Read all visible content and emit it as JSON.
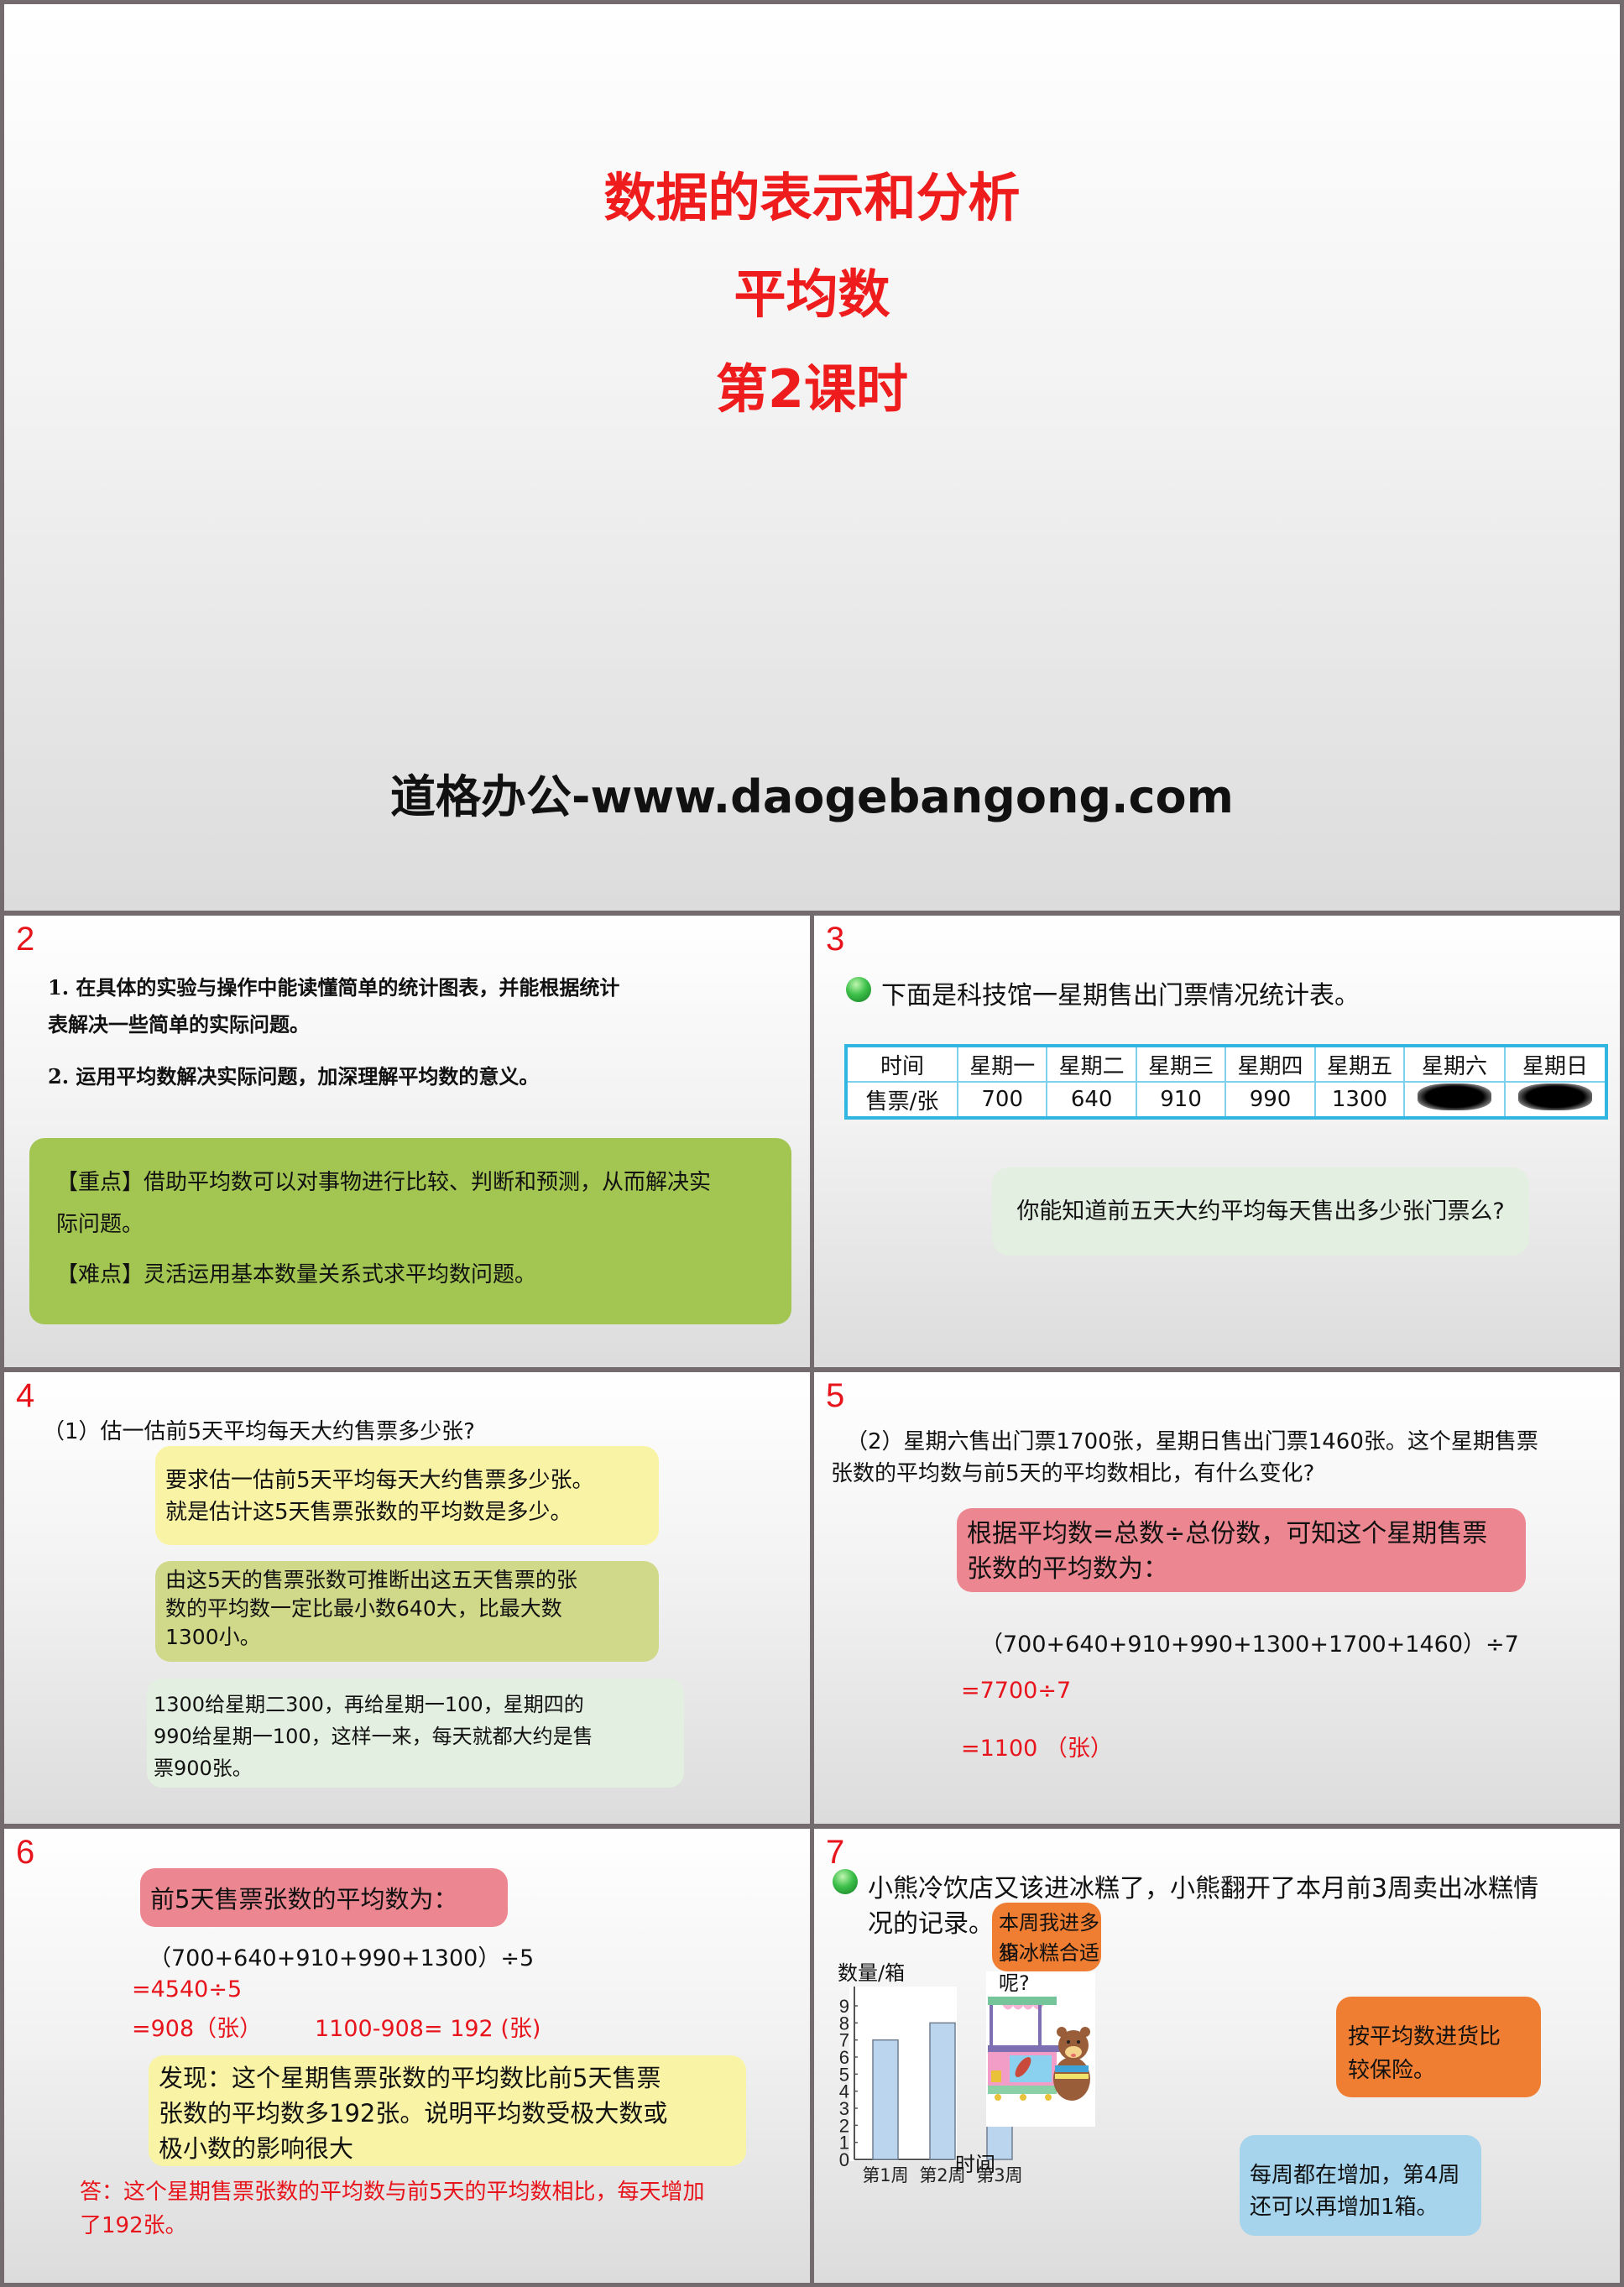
{
  "slide1": {
    "title": "数据的表示和分析",
    "subtitle": "平均数",
    "lesson": "第2课时",
    "brand": "道格办公-www.daogebangong.com"
  },
  "slide2": {
    "number": "2",
    "objectives": [
      "1. 在具体的实验与操作中能读懂简单的统计图表，并能根据统计",
      "表解决一些简单的实际问题。",
      "2. 运用平均数解决实际问题，加深理解平均数的意义。"
    ],
    "key_point_line1": "【重点】借助平均数可以对事物进行比较、判断和预测，从而解决实",
    "key_point_line2": "际问题。",
    "difficulty": "【难点】灵活运用基本数量关系式求平均数问题。"
  },
  "slide3": {
    "number": "3",
    "lead": "下面是科技馆一星期售出门票情况统计表。",
    "table": {
      "header": [
        "时间",
        "星期一",
        "星期二",
        "星期三",
        "星期四",
        "星期五",
        "星期六",
        "星期日"
      ],
      "row_label": "售票/张",
      "values": [
        "700",
        "640",
        "910",
        "990",
        "1300",
        "",
        ""
      ],
      "obscured": [
        false,
        false,
        false,
        false,
        false,
        true,
        true
      ]
    },
    "question": "你能知道前五天大约平均每天售出多少张门票么?"
  },
  "slide4": {
    "number": "4",
    "question": "（1）估一估前5天平均每天大约售票多少张?",
    "bubble1": [
      "要求估一估前5天平均每天大约售票多少张。",
      "就是估计这5天售票张数的平均数是多少。"
    ],
    "bubble2": [
      "由这5天的售票张数可推断出这五天售票的张",
      "数的平均数一定比最小数640大，比最大数",
      "1300小。"
    ],
    "bubble3": [
      "1300给星期二300，再给星期一100，星期四的",
      "990给星期一100，这样一来，每天就都大约是售",
      "票900张。"
    ]
  },
  "slide5": {
    "number": "5",
    "question": [
      "（2）星期六售出门票1700张，星期日售出门票1460张。这个星期售票",
      "张数的平均数与前5天的平均数相比，有什么变化?"
    ],
    "bubble": [
      "根据平均数=总数÷总份数，可知这个星期售票",
      "张数的平均数为："
    ],
    "formula": "（700+640+910+990+1300+1700+1460）÷7",
    "step1": "=7700÷7",
    "step2": "=1100 （张）"
  },
  "slide6": {
    "number": "6",
    "bubble": "前5天售票张数的平均数为：",
    "formula": "（700+640+910+990+1300）÷5",
    "step1": "=4540÷5",
    "step2": "=908（张）",
    "diff": "1100-908= 192 (张)",
    "finding": [
      "发现：这个星期售票张数的平均数比前5天售票",
      "张数的平均数多192张。说明平均数受极大数或",
      "极小数的影响很大"
    ],
    "answer": [
      "答：这个星期售票张数的平均数与前5天的平均数相比，每天增加",
      "了192张。"
    ]
  },
  "slide7": {
    "number": "7",
    "lead": [
      "小熊冷饮店又该进冰糕了，小熊翻开了本月前3周卖出冰糕情",
      "况的记录。"
    ],
    "bubble_question": [
      "本周我进多少",
      "箱冰糕合适呢?"
    ],
    "bubble_average": [
      "按平均数进货比",
      "较保险。"
    ],
    "bubble_increase": [
      "每周都在增加，第4周",
      "还可以再增加1箱。"
    ],
    "illustration": "bear-ice-cream-cart",
    "chart_data": {
      "type": "bar",
      "title": "",
      "ylabel": "数量/箱",
      "xlabel": "时间",
      "categories": [
        "第1周",
        "第2周",
        "第3周"
      ],
      "values": [
        7,
        8,
        9
      ],
      "ylim": [
        0,
        9
      ],
      "yticks": [
        "0",
        "1",
        "2",
        "3",
        "4",
        "5",
        "6",
        "7",
        "8",
        "9"
      ],
      "grid": false,
      "bar_color": "#bcd5ee"
    }
  }
}
